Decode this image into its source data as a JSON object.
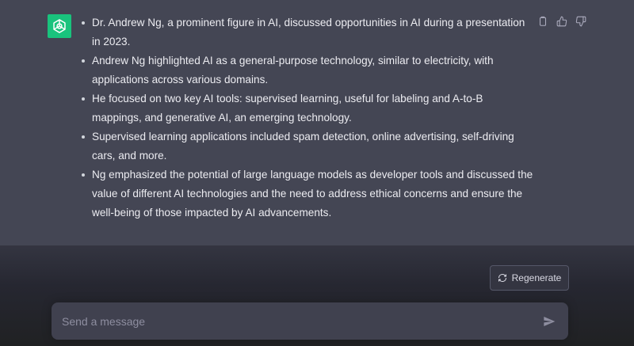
{
  "message": {
    "avatar_icon": "openai-logo-icon",
    "avatar_color": "#19c37d",
    "bullets": [
      "Dr. Andrew Ng, a prominent figure in AI, discussed opportunities in AI during a presentation in 2023.",
      "Andrew Ng highlighted AI as a general-purpose technology, similar to electricity, with applications across various domains.",
      "He focused on two key AI tools: supervised learning, useful for labeling and A-to-B mappings, and generative AI, an emerging technology.",
      "Supervised learning applications included spam detection, online advertising, self-driving cars, and more.",
      "Ng emphasized the potential of large language models as developer tools and discussed the value of different AI technologies and the need to address ethical concerns and ensure the well-being of those impacted by AI advancements."
    ],
    "actions": [
      "copy-icon",
      "thumbs-up-icon",
      "thumbs-down-icon"
    ]
  },
  "controls": {
    "regenerate_label": "Regenerate",
    "regenerate_icon": "refresh-icon"
  },
  "composer": {
    "placeholder": "Send a message",
    "value": "",
    "send_icon": "send-icon"
  },
  "colors": {
    "message_bg": "#444654",
    "page_bg": "#202123",
    "composer_bg": "#40414f",
    "text": "#ececf1"
  }
}
